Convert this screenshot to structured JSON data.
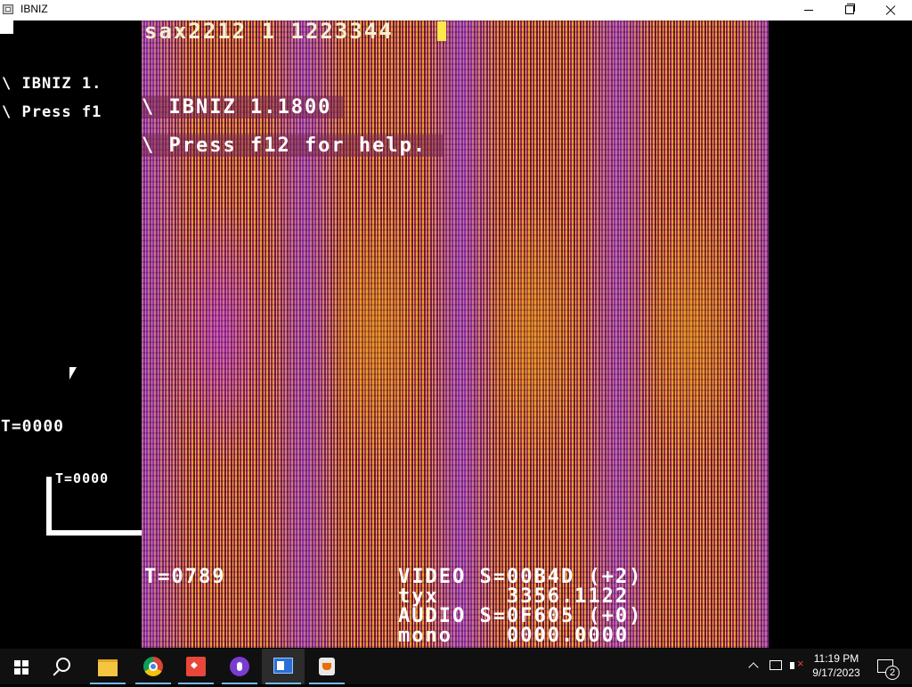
{
  "window": {
    "title": "IBNIZ"
  },
  "left_panel": {
    "version_text": "\\ IBNIZ 1.",
    "help_text": "\\ Press f1",
    "t_text": "T=0000",
    "box_label": "T=0000"
  },
  "viz": {
    "code": "sax2212 1 1223344",
    "banner_version": "\\ IBNIZ 1.1800",
    "banner_help": "\\ Press f12 for help.",
    "hud_t": "T=0789",
    "hud_video": "VIDEO S=00B4D (+2)",
    "hud_tyx": "tyx     3356.1122",
    "hud_audio": "AUDIO S=0F605 (+0)",
    "hud_mono": "mono    0000.0000"
  },
  "taskbar": {
    "icons": [
      "windows-start-icon",
      "search-icon",
      "file-explorer-icon",
      "chrome-icon",
      "git-icon",
      "podcast-icon",
      "ibniz-app-icon",
      "java-icon"
    ],
    "clock_time": "11:19 PM",
    "clock_date": "9/17/2023",
    "notification_count": "2"
  },
  "colors": {
    "accent": "#76b9ed",
    "taskbar": "#101010"
  }
}
